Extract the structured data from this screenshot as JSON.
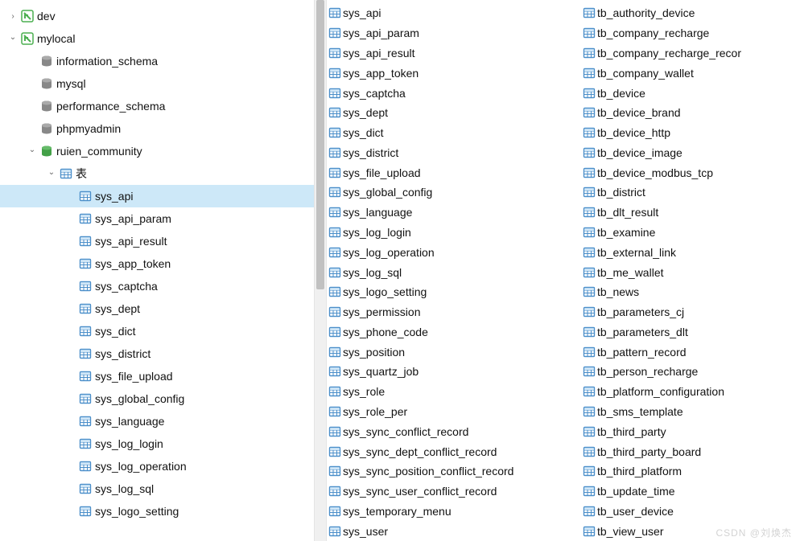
{
  "tree": [
    {
      "indent": 0,
      "arrow": "right",
      "icon": "conn",
      "label": "dev",
      "interact": true
    },
    {
      "indent": 0,
      "arrow": "down",
      "icon": "conn",
      "label": "mylocal",
      "interact": true
    },
    {
      "indent": 1,
      "arrow": "blank",
      "icon": "db-gray",
      "label": "information_schema",
      "interact": true
    },
    {
      "indent": 1,
      "arrow": "blank",
      "icon": "db-gray",
      "label": "mysql",
      "interact": true
    },
    {
      "indent": 1,
      "arrow": "blank",
      "icon": "db-gray",
      "label": "performance_schema",
      "interact": true
    },
    {
      "indent": 1,
      "arrow": "blank",
      "icon": "db-gray",
      "label": "phpmyadmin",
      "interact": true
    },
    {
      "indent": 1,
      "arrow": "down",
      "icon": "db-green",
      "label": "ruien_community",
      "interact": true
    },
    {
      "indent": 2,
      "arrow": "down",
      "icon": "table",
      "label": "表",
      "interact": true
    },
    {
      "indent": 3,
      "arrow": "blank",
      "icon": "table",
      "label": "sys_api",
      "interact": true,
      "selected": true
    },
    {
      "indent": 3,
      "arrow": "blank",
      "icon": "table",
      "label": "sys_api_param",
      "interact": true
    },
    {
      "indent": 3,
      "arrow": "blank",
      "icon": "table",
      "label": "sys_api_result",
      "interact": true
    },
    {
      "indent": 3,
      "arrow": "blank",
      "icon": "table",
      "label": "sys_app_token",
      "interact": true
    },
    {
      "indent": 3,
      "arrow": "blank",
      "icon": "table",
      "label": "sys_captcha",
      "interact": true
    },
    {
      "indent": 3,
      "arrow": "blank",
      "icon": "table",
      "label": "sys_dept",
      "interact": true
    },
    {
      "indent": 3,
      "arrow": "blank",
      "icon": "table",
      "label": "sys_dict",
      "interact": true
    },
    {
      "indent": 3,
      "arrow": "blank",
      "icon": "table",
      "label": "sys_district",
      "interact": true
    },
    {
      "indent": 3,
      "arrow": "blank",
      "icon": "table",
      "label": "sys_file_upload",
      "interact": true
    },
    {
      "indent": 3,
      "arrow": "blank",
      "icon": "table",
      "label": "sys_global_config",
      "interact": true
    },
    {
      "indent": 3,
      "arrow": "blank",
      "icon": "table",
      "label": "sys_language",
      "interact": true
    },
    {
      "indent": 3,
      "arrow": "blank",
      "icon": "table",
      "label": "sys_log_login",
      "interact": true
    },
    {
      "indent": 3,
      "arrow": "blank",
      "icon": "table",
      "label": "sys_log_operation",
      "interact": true
    },
    {
      "indent": 3,
      "arrow": "blank",
      "icon": "table",
      "label": "sys_log_sql",
      "interact": true
    },
    {
      "indent": 3,
      "arrow": "blank",
      "icon": "table",
      "label": "sys_logo_setting",
      "interact": true
    }
  ],
  "list_col1": [
    "sys_api",
    "sys_api_param",
    "sys_api_result",
    "sys_app_token",
    "sys_captcha",
    "sys_dept",
    "sys_dict",
    "sys_district",
    "sys_file_upload",
    "sys_global_config",
    "sys_language",
    "sys_log_login",
    "sys_log_operation",
    "sys_log_sql",
    "sys_logo_setting",
    "sys_permission",
    "sys_phone_code",
    "sys_position",
    "sys_quartz_job",
    "sys_role",
    "sys_role_per",
    "sys_sync_conflict_record",
    "sys_sync_dept_conflict_record",
    "sys_sync_position_conflict_record",
    "sys_sync_user_conflict_record",
    "sys_temporary_menu",
    "sys_user"
  ],
  "list_col2": [
    "tb_authority_device",
    "tb_company_recharge",
    "tb_company_recharge_recor",
    "tb_company_wallet",
    "tb_device",
    "tb_device_brand",
    "tb_device_http",
    "tb_device_image",
    "tb_device_modbus_tcp",
    "tb_district",
    "tb_dlt_result",
    "tb_examine",
    "tb_external_link",
    "tb_me_wallet",
    "tb_news",
    "tb_parameters_cj",
    "tb_parameters_dlt",
    "tb_pattern_record",
    "tb_person_recharge",
    "tb_platform_configuration",
    "tb_sms_template",
    "tb_third_party",
    "tb_third_party_board",
    "tb_third_platform",
    "tb_update_time",
    "tb_user_device",
    "tb_view_user"
  ],
  "watermark": "CSDN @刘焕杰"
}
